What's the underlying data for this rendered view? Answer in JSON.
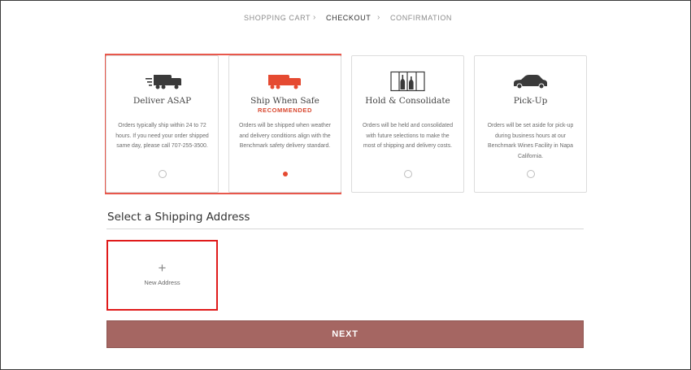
{
  "steps": [
    {
      "label": "SHOPPING CART"
    },
    {
      "label": "CHECKOUT"
    },
    {
      "label": "CONFIRMATION"
    }
  ],
  "step_separator": "›",
  "accent_color": "#e54a31",
  "shipping_options": [
    {
      "title": "Deliver ASAP",
      "badge": "",
      "description": "Orders typically ship within 24 to 72 hours. If you need your order shipped same day, please call 707-255-3500.",
      "icon": "delivery-truck-icon",
      "selected": false
    },
    {
      "title": "Ship When Safe",
      "badge": "RECOMMENDED",
      "description": "Orders will be shipped when weather and delivery conditions align with the Benchmark safety delivery standard.",
      "icon": "truck-icon",
      "selected": true
    },
    {
      "title": "Hold & Consolidate",
      "badge": "",
      "description": "Orders will be held and consolidated with future selections to make the most of shipping and delivery costs.",
      "icon": "wine-storage-icon",
      "selected": false
    },
    {
      "title": "Pick-Up",
      "badge": "",
      "description": "Orders will be set aside for pick-up during business hours at our Benchmark Wines Facility in Napa California.",
      "icon": "car-icon",
      "selected": false
    }
  ],
  "address_section": {
    "title": "Select a Shipping Address",
    "new_address_plus": "+",
    "new_address_label": "New Address"
  },
  "next_button": "NEXT"
}
